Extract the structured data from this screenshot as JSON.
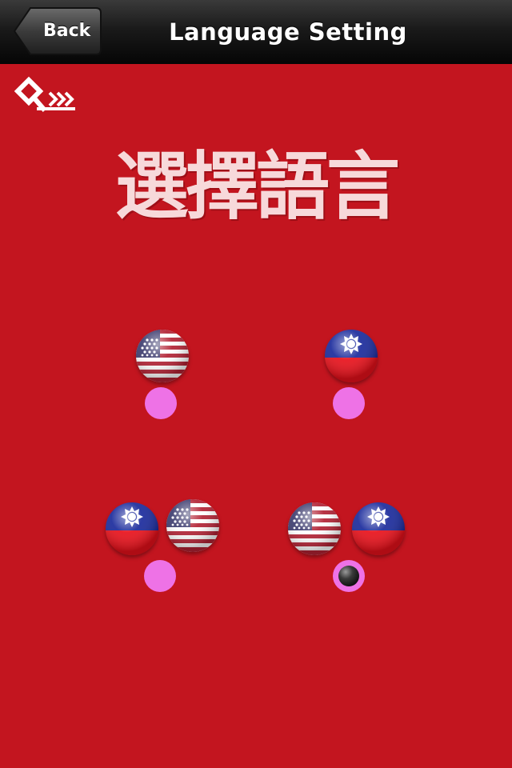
{
  "nav": {
    "back_label": "Back",
    "title": "Language Setting"
  },
  "logo": {
    "icon": "qkk-logo"
  },
  "heading": "選擇語言",
  "options": [
    {
      "flags": [
        "us-flag"
      ],
      "selected": false
    },
    {
      "flags": [
        "taiwan-flag"
      ],
      "selected": false
    },
    {
      "flags": [
        "taiwan-flag",
        "us-flag"
      ],
      "selected": false
    },
    {
      "flags": [
        "us-flag",
        "taiwan-flag"
      ],
      "selected": true
    }
  ],
  "colors": {
    "background": "#c3151f",
    "radio": "#ee72e6",
    "heading": "#f7d9da"
  }
}
